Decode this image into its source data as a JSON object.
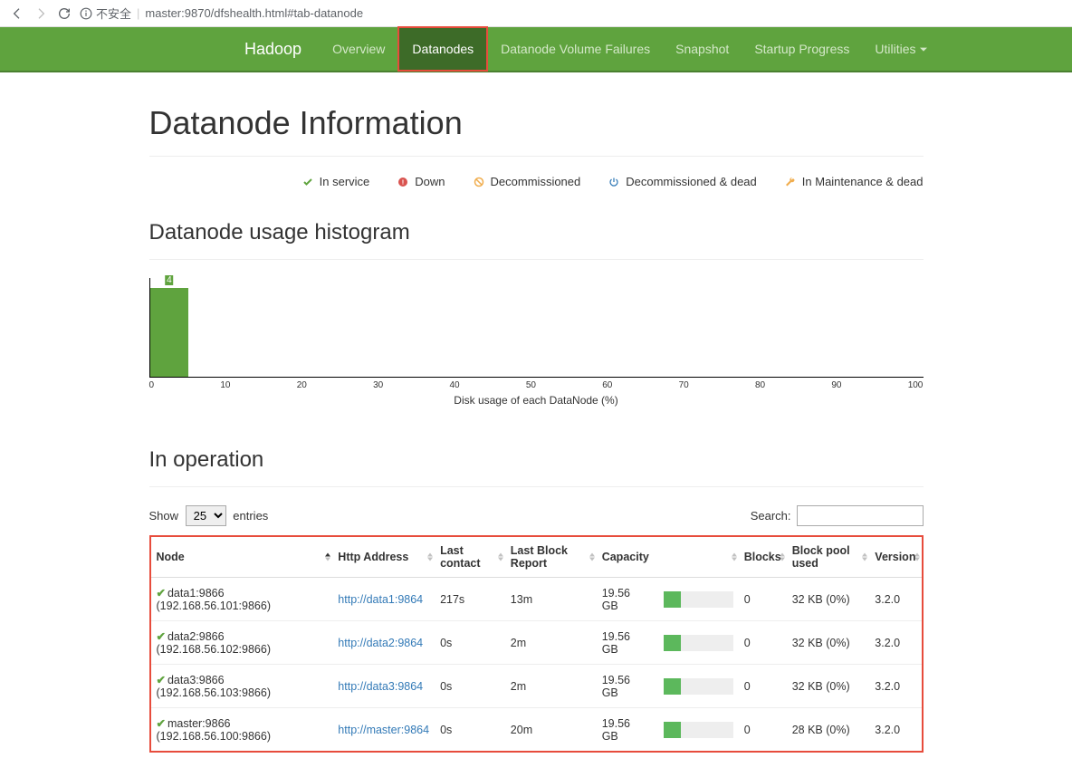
{
  "browser": {
    "insecure_text": "不安全",
    "url": "master:9870/dfshealth.html#tab-datanode"
  },
  "navbar": {
    "brand": "Hadoop",
    "items": [
      {
        "label": "Overview",
        "active": false
      },
      {
        "label": "Datanodes",
        "active": true
      },
      {
        "label": "Datanode Volume Failures",
        "active": false
      },
      {
        "label": "Snapshot",
        "active": false
      },
      {
        "label": "Startup Progress",
        "active": false
      },
      {
        "label": "Utilities",
        "active": false,
        "dropdown": true
      }
    ]
  },
  "page_title": "Datanode Information",
  "legend": [
    {
      "label": "In service",
      "icon": "check",
      "color": "#5fa33e"
    },
    {
      "label": "Down",
      "icon": "exclaim",
      "color": "#d9534f"
    },
    {
      "label": "Decommissioned",
      "icon": "ban",
      "color": "#f0ad4e"
    },
    {
      "label": "Decommissioned & dead",
      "icon": "power",
      "color": "#337ab7"
    },
    {
      "label": "In Maintenance & dead",
      "icon": "wrench",
      "color": "#f0ad4e"
    }
  ],
  "histogram_title": "Datanode usage histogram",
  "chart_data": {
    "type": "bar",
    "categories": [
      0,
      10,
      20,
      30,
      40,
      50,
      60,
      70,
      80,
      90,
      100
    ],
    "values": [
      4,
      0,
      0,
      0,
      0,
      0,
      0,
      0,
      0,
      0
    ],
    "xlabel": "Disk usage of each DataNode (%)",
    "ylabel": "",
    "xlim": [
      0,
      100
    ]
  },
  "in_operation_title": "In operation",
  "table": {
    "show_label": "Show",
    "entries_label": "entries",
    "page_size": "25",
    "search_label": "Search:",
    "search_value": "",
    "columns": [
      "Node",
      "Http Address",
      "Last contact",
      "Last Block Report",
      "Capacity",
      "Blocks",
      "Block pool used",
      "Version"
    ],
    "rows": [
      {
        "node": "data1:9866 (192.168.56.101:9866)",
        "http": "http://data1:9864",
        "last_contact": "217s",
        "last_block": "13m",
        "capacity": "19.56 GB",
        "cap_fill": 25,
        "blocks": "0",
        "pool": "32 KB (0%)",
        "version": "3.2.0"
      },
      {
        "node": "data2:9866 (192.168.56.102:9866)",
        "http": "http://data2:9864",
        "last_contact": "0s",
        "last_block": "2m",
        "capacity": "19.56 GB",
        "cap_fill": 25,
        "blocks": "0",
        "pool": "32 KB (0%)",
        "version": "3.2.0"
      },
      {
        "node": "data3:9866 (192.168.56.103:9866)",
        "http": "http://data3:9864",
        "last_contact": "0s",
        "last_block": "2m",
        "capacity": "19.56 GB",
        "cap_fill": 25,
        "blocks": "0",
        "pool": "32 KB (0%)",
        "version": "3.2.0"
      },
      {
        "node": "master:9866 (192.168.56.100:9866)",
        "http": "http://master:9864",
        "last_contact": "0s",
        "last_block": "20m",
        "capacity": "19.56 GB",
        "cap_fill": 25,
        "blocks": "0",
        "pool": "28 KB (0%)",
        "version": "3.2.0"
      }
    ]
  }
}
